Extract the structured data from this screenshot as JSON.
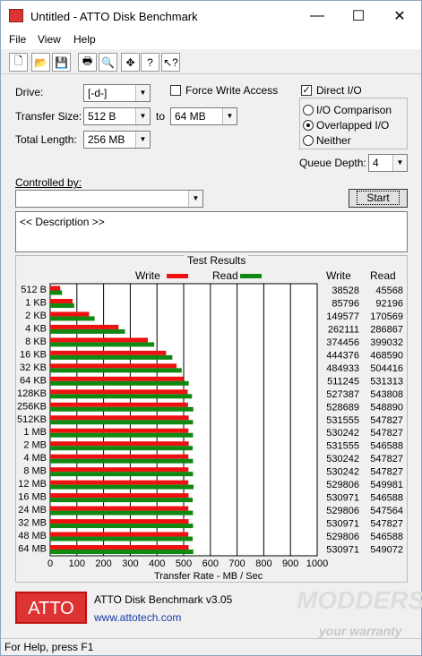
{
  "window": {
    "title": "Untitled - ATTO Disk Benchmark",
    "minimize": "—",
    "maximize": "☐",
    "close": "✕"
  },
  "menu": [
    "File",
    "View",
    "Help"
  ],
  "toolbar": [
    "new-icon",
    "open-icon",
    "save-icon",
    "print-icon",
    "print-preview-icon",
    "move-icon",
    "help-icon",
    "context-help-icon"
  ],
  "toolbar_glyphs": [
    "🗋",
    "📂",
    "💾",
    "🖶",
    "🔍",
    "✥",
    "?",
    "↖?"
  ],
  "settings": {
    "drive_label": "Drive:",
    "drive_value": "[-d-]",
    "transfer_size_label": "Transfer Size:",
    "transfer_from": "512 B",
    "to_label": "to",
    "transfer_to": "64 MB",
    "total_length_label": "Total Length:",
    "total_length_value": "256 MB",
    "force_write_label": "Force Write Access",
    "force_write_checked": false,
    "direct_io_label": "Direct I/O",
    "direct_io_checked": true,
    "io_comparison_label": "I/O Comparison",
    "overlapped_io_label": "Overlapped I/O",
    "neither_label": "Neither",
    "queue_depth_label": "Queue Depth:",
    "queue_depth_value": "4",
    "controlled_by_label": "Controlled by:",
    "controlled_by_value": "",
    "start_label": "Start",
    "description_placeholder": "<< Description >>"
  },
  "results": {
    "title": "Test Results",
    "write_legend": "Write",
    "read_legend": "Read",
    "write_col_header": "Write",
    "read_col_header": "Read",
    "xlabel": "Transfer Rate - MB / Sec",
    "write_color": "#ee1111",
    "read_color": "#118811"
  },
  "chart_data": {
    "type": "bar",
    "xlabel": "Transfer Rate - MB / Sec",
    "xlim": [
      0,
      1000
    ],
    "xticks": [
      "0",
      "100",
      "200",
      "300",
      "400",
      "500",
      "600",
      "700",
      "800",
      "900",
      "1000"
    ],
    "categories": [
      "512 B",
      "1 KB",
      "2 KB",
      "4 KB",
      "8 KB",
      "16 KB",
      "32 KB",
      "64 KB",
      "128KB",
      "256KB",
      "512KB",
      "1 MB",
      "2 MB",
      "4 MB",
      "8 MB",
      "12 MB",
      "16 MB",
      "24 MB",
      "32 MB",
      "48 MB",
      "64 MB"
    ],
    "series": [
      {
        "name": "Write",
        "values": [
          38528,
          85796,
          149577,
          262111,
          374456,
          444376,
          484933,
          511245,
          527387,
          528689,
          531555,
          530242,
          531555,
          530242,
          530242,
          529806,
          530971,
          529806,
          530971,
          529806,
          530971
        ]
      },
      {
        "name": "Read",
        "values": [
          45568,
          92196,
          170569,
          286867,
          399032,
          468590,
          504416,
          531313,
          543808,
          548890,
          547827,
          547827,
          546588,
          547827,
          547827,
          549981,
          546588,
          547564,
          547827,
          546588,
          549072
        ]
      }
    ],
    "write_labels": [
      "38528",
      "85796",
      "149577",
      "262111",
      "374456",
      "444376",
      "484933",
      "511245",
      "527387",
      "528689",
      "531555",
      "530242",
      "531555",
      "530242",
      "530242",
      "529806",
      "530971",
      "529806",
      "530971",
      "529806",
      "530971"
    ],
    "read_labels": [
      "45568",
      "92196",
      "170569",
      "286867",
      "399032",
      "468590",
      "504416",
      "531313",
      "543808",
      "548890",
      "547827",
      "547827",
      "546588",
      "547827",
      "547827",
      "549981",
      "546588",
      "547564",
      "547827",
      "546588",
      "549072"
    ]
  },
  "branding": {
    "logo": "ATTO",
    "product": "ATTO Disk Benchmark v3.05",
    "url": "www.attotech.com",
    "watermark": "MODDERS",
    "watermark_sub": "your warranty"
  },
  "status": {
    "text": "For Help, press F1"
  }
}
